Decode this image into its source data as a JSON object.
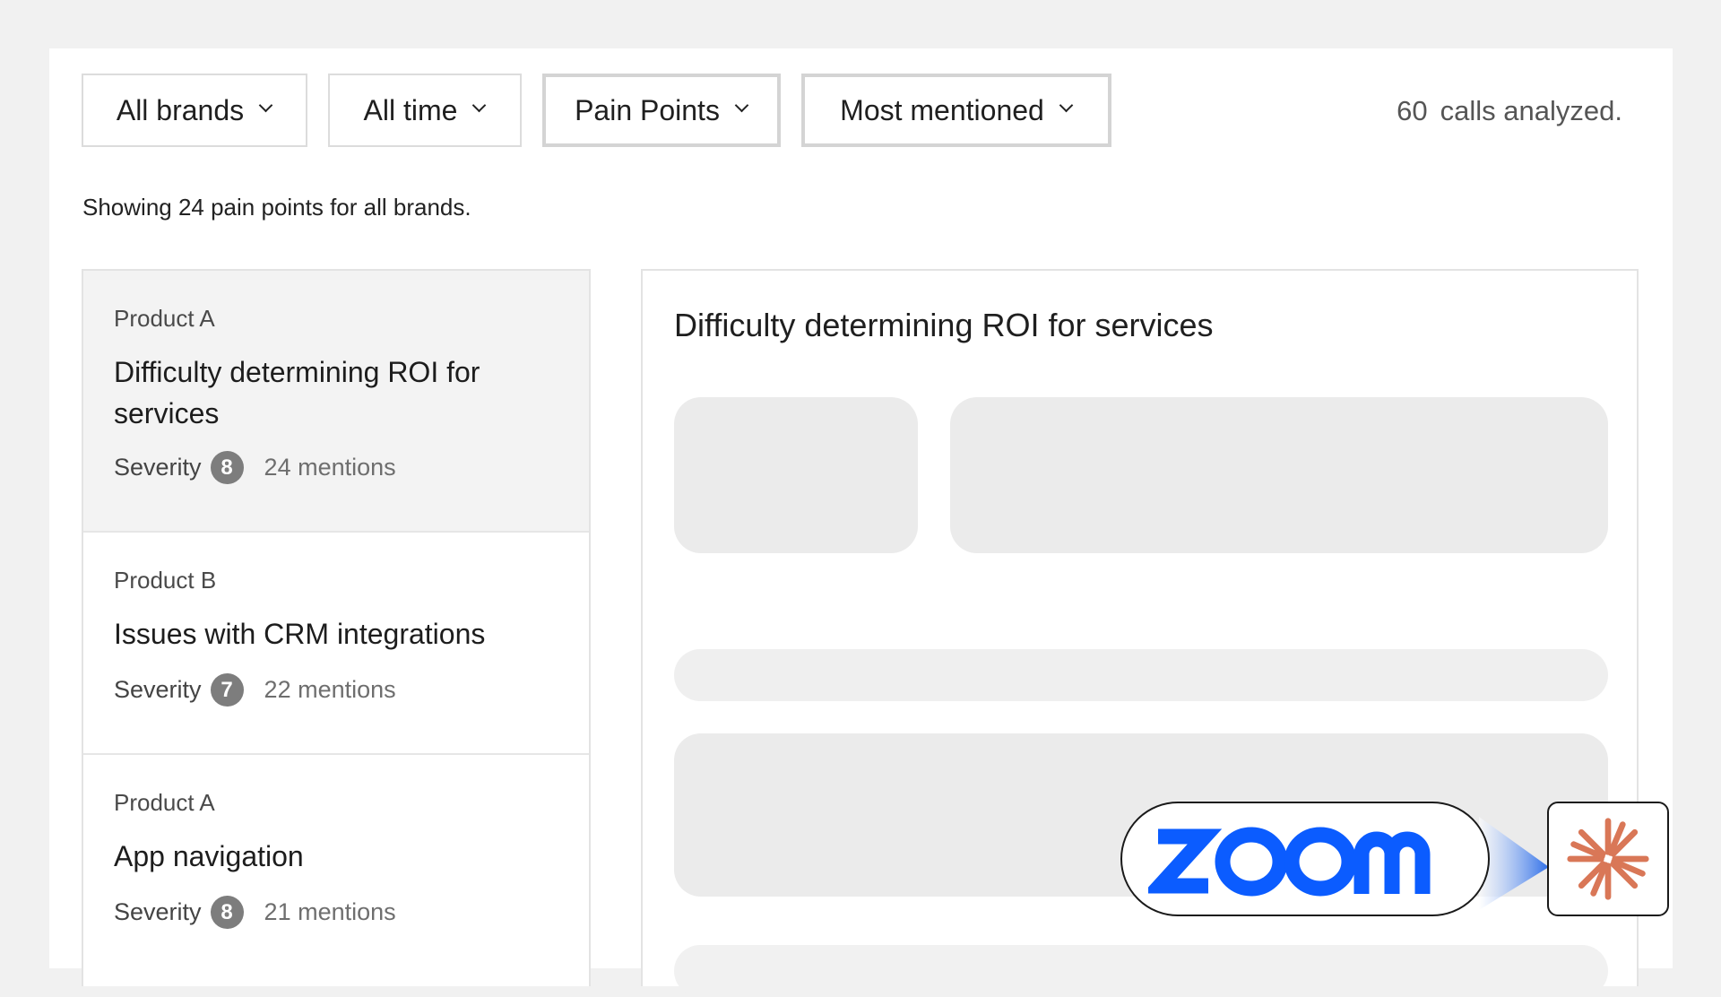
{
  "filters": {
    "brands": "All brands",
    "time": "All time",
    "category": "Pain Points",
    "sort": "Most mentioned"
  },
  "calls": {
    "count": "60",
    "label": "calls analyzed."
  },
  "summary": "Showing 24 pain points for all brands.",
  "items": [
    {
      "brand": "Product A",
      "title": "Difficulty determining ROI for services",
      "severity_label": "Severity",
      "severity": "8",
      "mentions": "24 mentions"
    },
    {
      "brand": "Product B",
      "title": "Issues with CRM integrations",
      "severity_label": "Severity",
      "severity": "7",
      "mentions": "22 mentions"
    },
    {
      "brand": "Product A",
      "title": "App navigation",
      "severity_label": "Severity",
      "severity": "8",
      "mentions": "21 mentions"
    }
  ],
  "detail": {
    "title": "Difficulty determining ROI for services"
  },
  "integration": {
    "source_logo": "zoom",
    "target_icon": "asterisk-icon",
    "brand_blue": "#0b5cff",
    "accent_orange": "#d97757"
  }
}
